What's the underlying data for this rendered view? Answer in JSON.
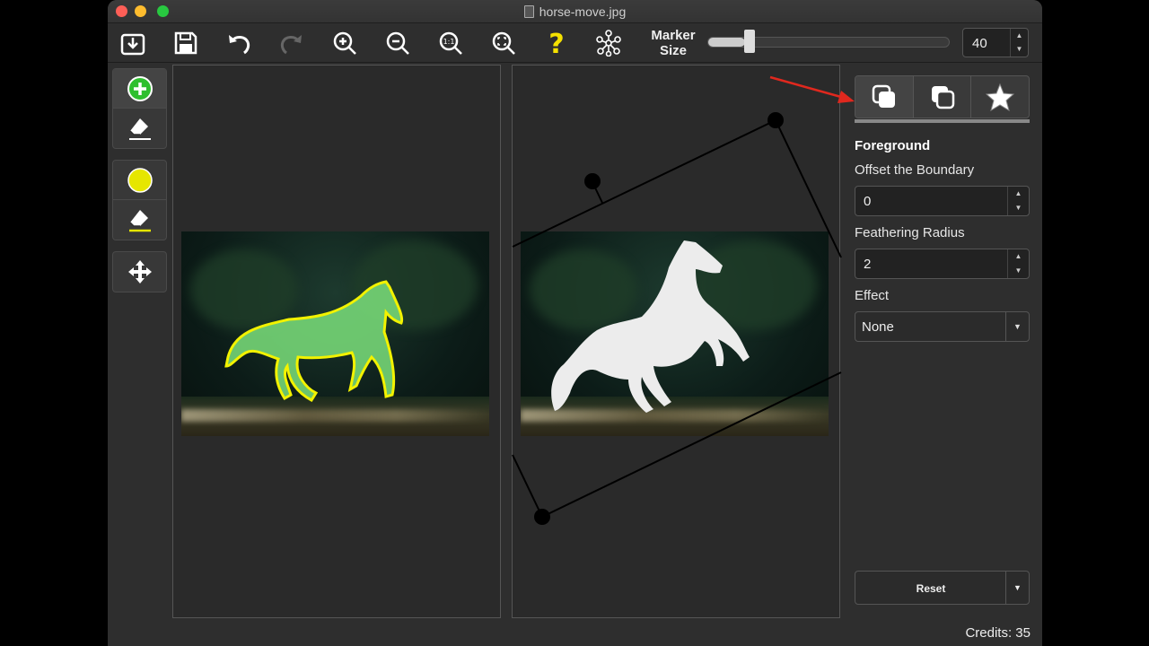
{
  "window": {
    "title": "horse-move.jpg"
  },
  "toolbar": {
    "marker_size_label_1": "Marker",
    "marker_size_label_2": "Size",
    "marker_size_value": "40",
    "marker_size_fraction": 0.15,
    "tools": [
      "open",
      "save",
      "undo",
      "redo",
      "zoom-in",
      "zoom-out",
      "actual-size",
      "zoom-fit",
      "help",
      "network"
    ]
  },
  "side_tools": {
    "groups": [
      [
        "add-foreground-marker",
        "erase-foreground-marker"
      ],
      [
        "background-marker",
        "erase-background-marker"
      ],
      [
        "move-tool"
      ]
    ]
  },
  "panel": {
    "section_title": "Foreground",
    "offset_label": "Offset the Boundary",
    "offset_value": "0",
    "feather_label": "Feathering Radius",
    "feather_value": "2",
    "effect_label": "Effect",
    "effect_value": "None",
    "reset_label": "Reset"
  },
  "status": {
    "credits": "Credits: 35"
  },
  "colors": {
    "accent_green": "#2fbf2f",
    "marker_yellow": "#e6e600",
    "selection_green": "#7be07b",
    "annotation_red": "#e0281e",
    "help_yellow": "#f5e100"
  }
}
